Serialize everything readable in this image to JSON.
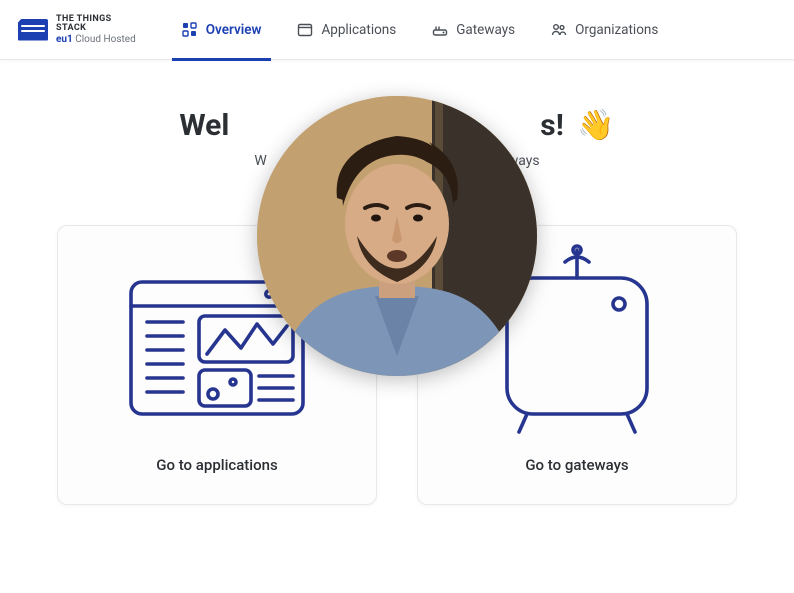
{
  "brand": {
    "line1": "THE THINGS",
    "line2": "STACK",
    "cluster_prefix": "eu1",
    "cluster_suffix": " Cloud Hosted"
  },
  "nav": {
    "overview": "Overview",
    "applications": "Applications",
    "gateways": "Gateways",
    "organizations": "Organizations"
  },
  "welcome": {
    "title_prefix": "Wel",
    "title_suffix": "s!",
    "wave": "👋",
    "subtitle_prefix": "W",
    "subtitle_suffix": "ways"
  },
  "cards": {
    "applications": "Go to applications",
    "gateways": "Go to gateways"
  }
}
